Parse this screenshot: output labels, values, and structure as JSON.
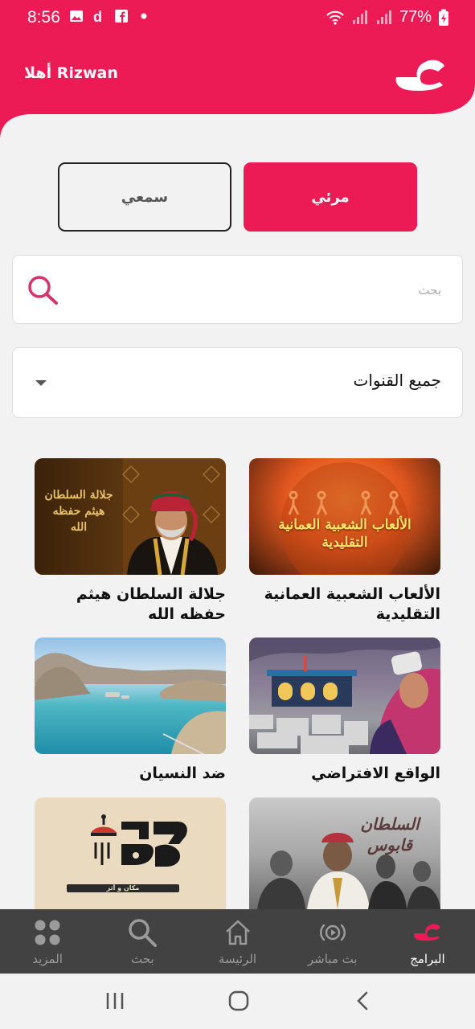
{
  "status_bar": {
    "time": "8:56",
    "battery": "77%"
  },
  "header": {
    "greeting": "أهلا Rizwan"
  },
  "toggle": {
    "visual_label": "مرئي",
    "audio_label": "سمعي"
  },
  "search": {
    "placeholder": "بحث",
    "value": ""
  },
  "filter": {
    "selected": "جميع القنوات"
  },
  "programs": [
    {
      "title": "الألعاب الشعبية العمانية التقليدية",
      "thumb_text": "الألعاب الشعبية العمانية التقليدية"
    },
    {
      "title": "جلالة السلطان هيثم حفظه الله",
      "thumb_text": "جلالة السلطان هيثم حفظه الله"
    },
    {
      "title": "الواقع الافتراضي",
      "thumb_text": ""
    },
    {
      "title": "ضد النسيان",
      "thumb_text": ""
    },
    {
      "title": "",
      "thumb_text": "السلطان قابوس"
    },
    {
      "title": "",
      "thumb_text": "مكان و أثر"
    }
  ],
  "bottom_nav": [
    {
      "label": "البرامج",
      "icon": "programs-logo-icon",
      "active": true
    },
    {
      "label": "بث مباشر",
      "icon": "live-broadcast-icon",
      "active": false
    },
    {
      "label": "الرئيسة",
      "icon": "home-icon",
      "active": false
    },
    {
      "label": "بحث",
      "icon": "search-icon",
      "active": false
    },
    {
      "label": "المزيد",
      "icon": "more-grid-icon",
      "active": false
    }
  ],
  "colors": {
    "accent": "#ed1b55",
    "nav_bg": "#424242",
    "page_bg": "#f2f2f2"
  }
}
